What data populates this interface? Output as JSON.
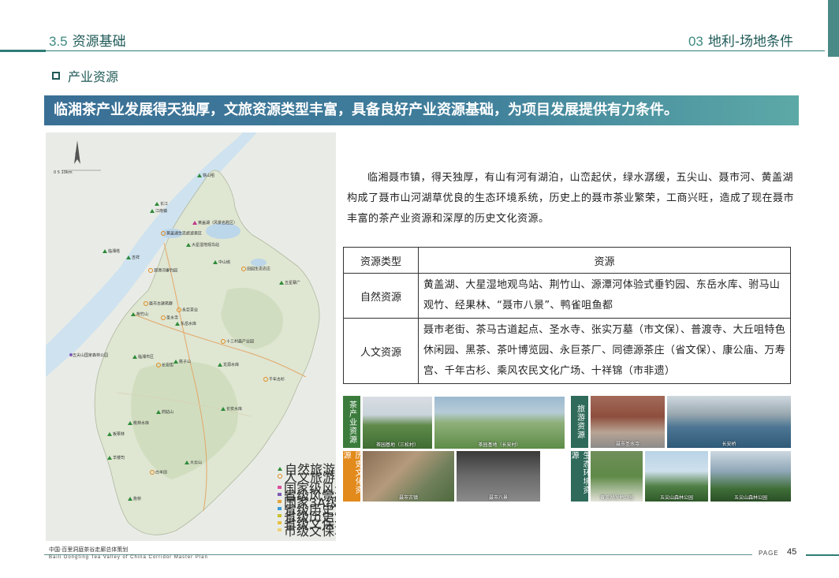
{
  "header": {
    "left_num": "3.5",
    "left_title": "资源基础",
    "right_num": "03",
    "right_title": "地利-场地条件"
  },
  "section": {
    "title": "产业资源"
  },
  "banner": {
    "text": "临湘茶产业发展得天独厚，文旅资源类型丰富，具备良好产业资源基础，为项目发展提供有力条件。"
  },
  "paragraph": "临湘聂市镇，得天独厚，有山有河有湖泊，山峦起伏，绿水潺缓，五尖山、聂市河、黄盖湖构成了聂市山河湖草优良的生态环境系统，历史上的聂市茶业繁荣，工商兴旺，造成了现在聂市丰富的茶产业资源和深厚的历史文化资源。",
  "table": {
    "headers": [
      "资源类型",
      "资源"
    ],
    "rows": [
      {
        "type": "自然资源",
        "value": "黄盖湖、大星湿地观鸟站、荆竹山、源潭河体验式垂钓园、东岳水库、驸马山观竹、经果林、“聂市八景”、鸭雀咀鱼都"
      },
      {
        "type": "人文资源",
        "value": "聂市老街、茶马古道起点、圣水寺、张实万墓（市文保）、普渡寺、大丘咀特色休闲园、黑茶、茶叶博览园、永巨茶厂、同德源茶庄（省文保）、康公庙、万寿宫、千年古杉、乘风农民文化广场、十祥锦（市非遗）"
      }
    ]
  },
  "photos": {
    "tea": {
      "label": "茶产业资源",
      "captions": [
        "茶园基地（三松村）",
        "茶园基地（长安村）"
      ]
    },
    "history": {
      "label": "历史文化资源",
      "captions": [
        "聂市古镇",
        "聂市八景"
      ]
    },
    "tourism": {
      "label": "旅游资源",
      "captions": [
        "聂市圣水寺",
        "长安桥"
      ]
    },
    "eco": {
      "label": "生态环境资源",
      "captions": [
        "黄盖湖湿地公园",
        "五尖山森林公园",
        "五尖山森林公园"
      ]
    }
  },
  "map": {
    "scale_text": "0   5   10km",
    "places": [
      {
        "name": "黄盖湖（风景名胜区）",
        "kind": "pink-tri"
      },
      {
        "name": "长江",
        "kind": "tri"
      },
      {
        "name": "铁山咀",
        "kind": "tri"
      },
      {
        "name": "江南镇",
        "kind": "tri"
      },
      {
        "name": "黄盖湖生态旅游景区",
        "kind": "ring"
      },
      {
        "name": "大星湿地观鸟站",
        "kind": "tri"
      },
      {
        "name": "临湘塔",
        "kind": "tri"
      },
      {
        "name": "吉祥",
        "kind": "tri"
      },
      {
        "name": "源潭河垂钓园",
        "kind": "ring"
      },
      {
        "name": "中山坳",
        "kind": "tri"
      },
      {
        "name": "田园生态农庄",
        "kind": "ring"
      },
      {
        "name": "五星寨广",
        "kind": "tri"
      },
      {
        "name": "聂市古建筑群",
        "kind": "ring"
      },
      {
        "name": "永巨茶业",
        "kind": "ring"
      },
      {
        "name": "荆竹山",
        "kind": "tri"
      },
      {
        "name": "圣水寺",
        "kind": "ring"
      },
      {
        "name": "东岳水库",
        "kind": "tri"
      },
      {
        "name": "十三村森产业园",
        "kind": "ring"
      },
      {
        "name": "五尖山国家森林公园",
        "kind": "purple-dot"
      },
      {
        "name": "临湘市区",
        "kind": "tri"
      },
      {
        "name": "长安街",
        "kind": "ring"
      },
      {
        "name": "桃子山",
        "kind": "tri"
      },
      {
        "name": "龙源水库",
        "kind": "tri"
      },
      {
        "name": "千年古杉",
        "kind": "ring"
      },
      {
        "name": "药姑山",
        "kind": "tri"
      },
      {
        "name": "桃林水库",
        "kind": "tri"
      },
      {
        "name": "板栗林",
        "kind": "tri"
      },
      {
        "name": "长安水库",
        "kind": "tri"
      },
      {
        "name": "大云山",
        "kind": "tri"
      },
      {
        "name": "羊楼司",
        "kind": "tri"
      },
      {
        "name": "詹桥",
        "kind": "tri"
      },
      {
        "name": "白羊田",
        "kind": "ring"
      }
    ],
    "legend": [
      {
        "label": "自然旅游资源",
        "kind": "tri"
      },
      {
        "label": "人文旅游资源",
        "kind": "ring"
      },
      {
        "label": "国家级风景名胜区",
        "color": "#d94f9a"
      },
      {
        "label": "省级风景名胜区",
        "color": "#7d5bb5"
      },
      {
        "label": "国家3A级旅游景区",
        "color": "#e6a23c"
      },
      {
        "label": "省级历史文化名镇",
        "color": "#3a9ad9"
      },
      {
        "label": "省级历史文保单位",
        "color": "#c9c030"
      },
      {
        "label": "省级文保单位",
        "color": "#e6c040"
      },
      {
        "label": "市级文保单位",
        "color": "#f0d27a"
      }
    ]
  },
  "footer": {
    "cn": "中国·百里洞庭茶谷走廊总体策划",
    "en": "Baili Dongting Tea Valley of China Corridor Master Plan",
    "page_label": "PAGE",
    "page_num": "45"
  }
}
